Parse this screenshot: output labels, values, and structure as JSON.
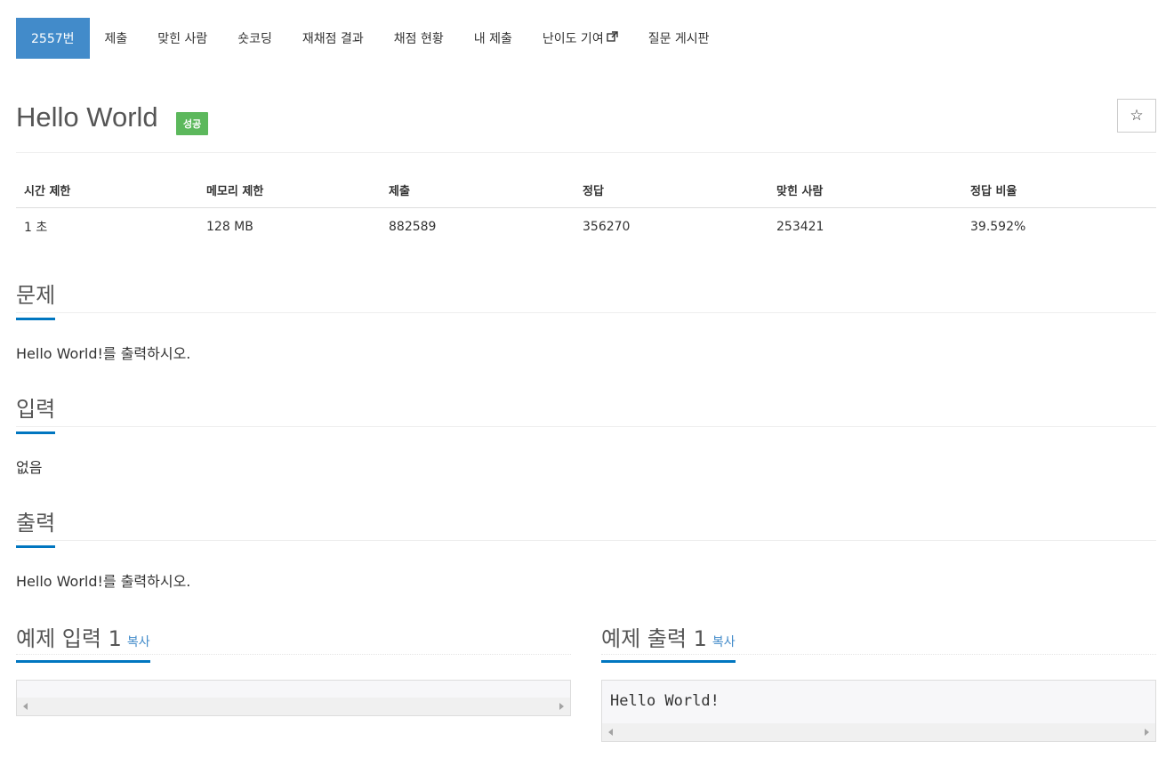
{
  "nav": {
    "items": [
      {
        "label": "2557번",
        "active": true
      },
      {
        "label": "제출"
      },
      {
        "label": "맞힌 사람"
      },
      {
        "label": "숏코딩"
      },
      {
        "label": "재채점 결과"
      },
      {
        "label": "채점 현황"
      },
      {
        "label": "내 제출"
      },
      {
        "label": "난이도 기여",
        "icon": "external-link-icon"
      },
      {
        "label": "질문 게시판"
      }
    ]
  },
  "problem": {
    "title": "Hello World",
    "badge": "성공",
    "star_icon": "☆"
  },
  "info_table": {
    "headers": [
      "시간 제한",
      "메모리 제한",
      "제출",
      "정답",
      "맞힌 사람",
      "정답 비율"
    ],
    "values": [
      "1 초",
      "128 MB",
      "882589",
      "356270",
      "253421",
      "39.592%"
    ]
  },
  "sections": {
    "description": {
      "title": "문제",
      "body": "Hello World!를 출력하시오."
    },
    "input": {
      "title": "입력",
      "body": "없음"
    },
    "output": {
      "title": "출력",
      "body": "Hello World!를 출력하시오."
    }
  },
  "samples": {
    "input": {
      "title": "예제 입력 1",
      "copy": "복사",
      "content": ""
    },
    "output": {
      "title": "예제 출력 1",
      "copy": "복사",
      "content": "Hello World!"
    }
  },
  "colors": {
    "active_tab": "#428bca",
    "badge_success": "#5cb85c",
    "section_underline": "#0076c0",
    "link": "#428bca"
  }
}
